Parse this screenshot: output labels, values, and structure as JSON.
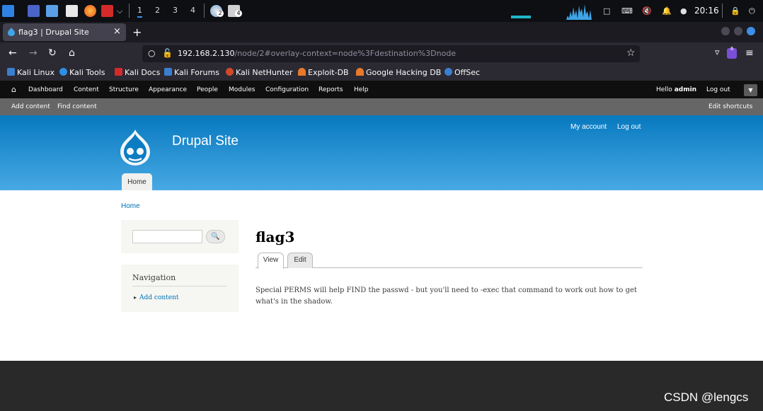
{
  "taskbar": {
    "workspaces": [
      "1",
      "2",
      "3",
      "4"
    ],
    "badges": [
      "2",
      "4"
    ],
    "clock": "20:16"
  },
  "browser": {
    "tab_title": "flag3 | Drupal Site",
    "tab_close": "×",
    "new_tab": "+",
    "url_host": "192.168.2.130",
    "url_path": "/node/2#overlay-context=node%3Fdestination%3Dnode",
    "extension_badge": "6",
    "bookmarks": [
      "Kali Linux",
      "Kali Tools",
      "Kali Docs",
      "Kali Forums",
      "Kali NetHunter",
      "Exploit-DB",
      "Google Hacking DB",
      "OffSec"
    ]
  },
  "drupal_toolbar": {
    "menu": [
      "Dashboard",
      "Content",
      "Structure",
      "Appearance",
      "People",
      "Modules",
      "Configuration",
      "Reports",
      "Help"
    ],
    "hello_prefix": "Hello ",
    "hello_user": "admin",
    "logout": "Log out",
    "shortcuts": [
      "Add content",
      "Find content"
    ],
    "edit_shortcuts": "Edit shortcuts"
  },
  "header": {
    "site_name": "Drupal Site",
    "secondary_links": [
      "My account",
      "Log out"
    ],
    "main_tab": "Home"
  },
  "page": {
    "breadcrumb": "Home",
    "search_button": "🔍",
    "nav_title": "Navigation",
    "nav_link": "Add content",
    "node_title": "flag3",
    "tabs": [
      "View",
      "Edit"
    ],
    "body": "Special PERMS will help FIND the passwd - but you'll need to -exec that command to work out how to get what's in the shadow."
  },
  "watermark": "CSDN @lengcs",
  "colors": {
    "header_top": "#0779bf",
    "header_bottom": "#48a9e4",
    "link": "#0071b3",
    "footer": "#292929"
  }
}
